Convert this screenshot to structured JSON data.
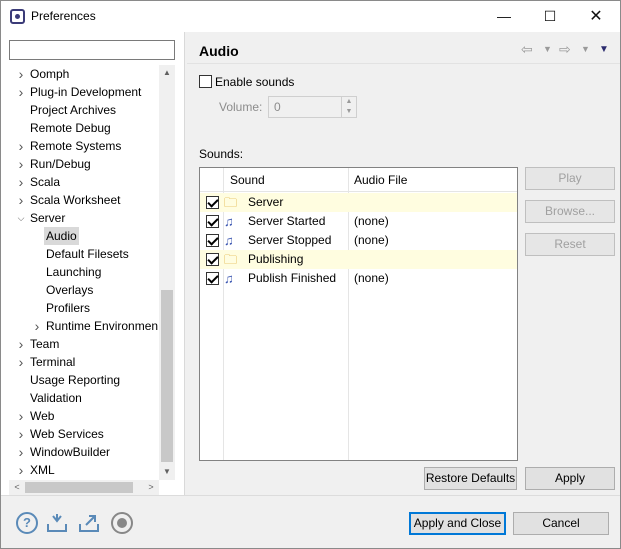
{
  "window": {
    "title": "Preferences"
  },
  "filter": {
    "value": "",
    "placeholder": ""
  },
  "tree": [
    {
      "label": "Oomph",
      "depth": 0,
      "expander": "collapsed"
    },
    {
      "label": "Plug-in Development",
      "depth": 0,
      "expander": "collapsed"
    },
    {
      "label": "Project Archives",
      "depth": 0,
      "expander": "none"
    },
    {
      "label": "Remote Debug",
      "depth": 0,
      "expander": "none"
    },
    {
      "label": "Remote Systems",
      "depth": 0,
      "expander": "collapsed"
    },
    {
      "label": "Run/Debug",
      "depth": 0,
      "expander": "collapsed"
    },
    {
      "label": "Scala",
      "depth": 0,
      "expander": "collapsed"
    },
    {
      "label": "Scala Worksheet",
      "depth": 0,
      "expander": "collapsed"
    },
    {
      "label": "Server",
      "depth": 0,
      "expander": "expanded"
    },
    {
      "label": "Audio",
      "depth": 1,
      "expander": "none",
      "selected": true
    },
    {
      "label": "Default Filesets",
      "depth": 1,
      "expander": "none"
    },
    {
      "label": "Launching",
      "depth": 1,
      "expander": "none"
    },
    {
      "label": "Overlays",
      "depth": 1,
      "expander": "none"
    },
    {
      "label": "Profilers",
      "depth": 1,
      "expander": "none"
    },
    {
      "label": "Runtime Environmen",
      "depth": 1,
      "expander": "collapsed"
    },
    {
      "label": "Team",
      "depth": 0,
      "expander": "collapsed"
    },
    {
      "label": "Terminal",
      "depth": 0,
      "expander": "collapsed"
    },
    {
      "label": "Usage Reporting",
      "depth": 0,
      "expander": "none"
    },
    {
      "label": "Validation",
      "depth": 0,
      "expander": "none"
    },
    {
      "label": "Web",
      "depth": 0,
      "expander": "collapsed"
    },
    {
      "label": "Web Services",
      "depth": 0,
      "expander": "collapsed"
    },
    {
      "label": "WindowBuilder",
      "depth": 0,
      "expander": "collapsed"
    },
    {
      "label": "XML",
      "depth": 0,
      "expander": "collapsed"
    }
  ],
  "page": {
    "title": "Audio",
    "enable_sounds": {
      "label": "Enable sounds",
      "checked": false
    },
    "volume": {
      "label": "Volume:",
      "value": "0"
    },
    "sounds_label": "Sounds:",
    "table": {
      "columns": [
        "Sound",
        "Audio File"
      ],
      "rows": [
        {
          "name": "Server",
          "file": "",
          "checked": true,
          "category": true,
          "icon": "folder-sound-icon"
        },
        {
          "name": "Server Started",
          "file": "(none)",
          "checked": true,
          "category": false,
          "icon": "music-note-icon"
        },
        {
          "name": "Server Stopped",
          "file": "(none)",
          "checked": true,
          "category": false,
          "icon": "music-note-icon"
        },
        {
          "name": "Publishing",
          "file": "",
          "checked": true,
          "category": true,
          "icon": "folder-sound-icon"
        },
        {
          "name": "Publish Finished",
          "file": "(none)",
          "checked": true,
          "category": false,
          "icon": "music-note-icon"
        }
      ]
    },
    "side_buttons": {
      "play": "Play",
      "browse": "Browse...",
      "reset": "Reset"
    },
    "restore_defaults": "Restore Defaults",
    "apply": "Apply"
  },
  "footer": {
    "apply_and_close": "Apply and Close",
    "cancel": "Cancel",
    "icons": [
      "help-icon",
      "import-icon",
      "export-icon",
      "record-icon"
    ]
  },
  "colors": {
    "accent": "#0078d7",
    "category_row": "#fffde0",
    "selection": "#d9d9d9"
  }
}
